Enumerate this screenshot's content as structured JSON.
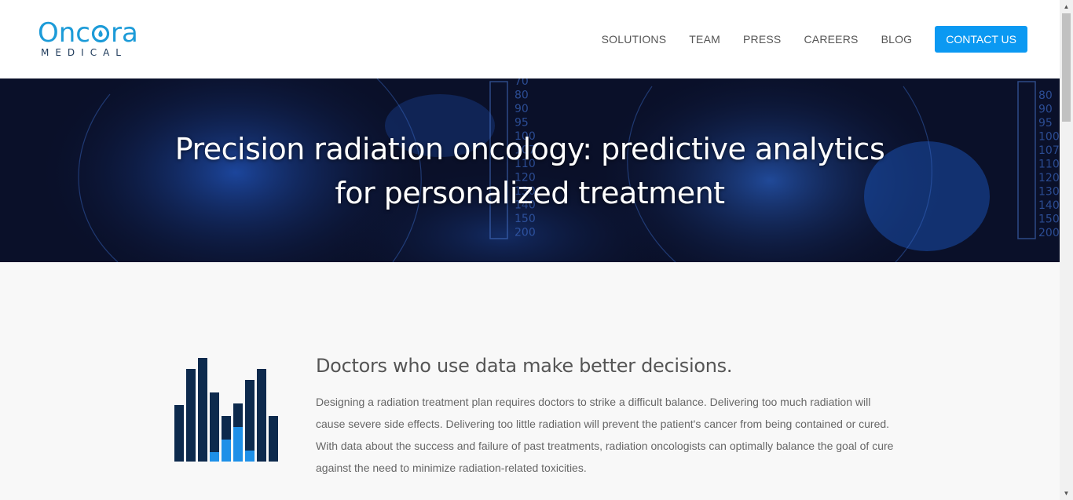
{
  "logo": {
    "word_pre": "Onc",
    "word_post": "ra",
    "sub": "MEDICAL",
    "brand_color": "#1c9bd8"
  },
  "nav": {
    "items": [
      {
        "label": "SOLUTIONS"
      },
      {
        "label": "TEAM"
      },
      {
        "label": "PRESS"
      },
      {
        "label": "CAREERS"
      },
      {
        "label": "BLOG"
      }
    ],
    "cta": "CONTACT US",
    "cta_color": "#0b99f2"
  },
  "hero": {
    "title": "Precision radiation oncology: predictive analytics for personalized treatment",
    "scale_left": [
      "70",
      "80",
      "90",
      "95",
      "100",
      "107",
      "110",
      "120",
      "130",
      "140",
      "150",
      "200"
    ],
    "scale_right": [
      "80",
      "90",
      "95",
      "100",
      "107",
      "110",
      "120",
      "130",
      "140",
      "150",
      "200"
    ]
  },
  "section": {
    "title": "Doctors who use data make better decisions.",
    "text": "Designing a radiation treatment plan requires doctors to strike a difficult balance. Delivering too much radiation will cause severe side effects. Delivering too little radiation will prevent the patient's cancer from being contained or cured. With data about the success and failure of past treatments, radiation oncologists can optimally balance the goal of cure against the need to minimize radiation-related toxicities.",
    "icon": "bar-chart-illustration",
    "dark_color": "#0d2a4d",
    "light_color": "#1e90e8"
  },
  "scrollbar": {
    "up_icon": "▲",
    "down_icon": "▼"
  }
}
